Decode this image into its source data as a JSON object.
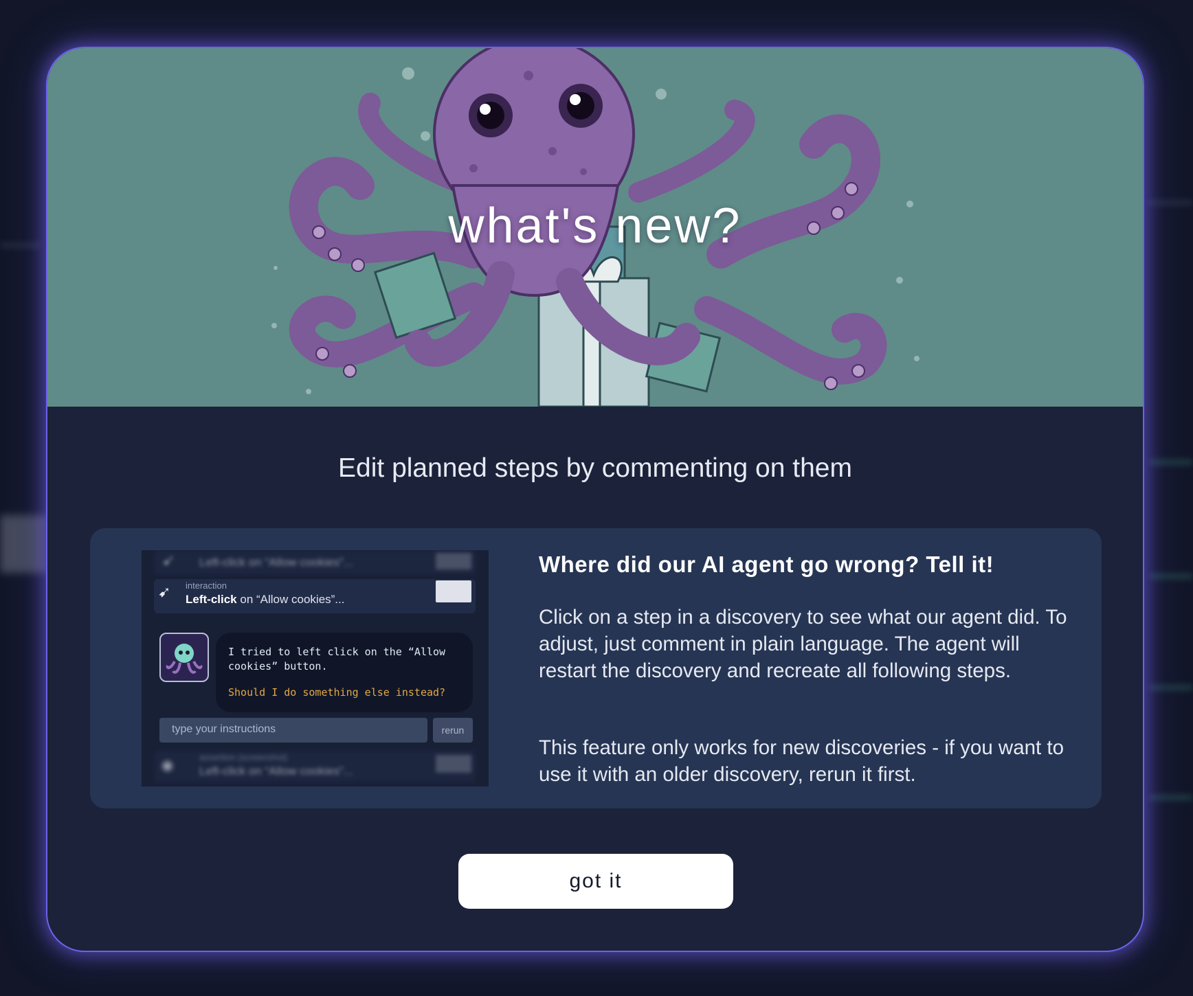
{
  "modal": {
    "title": "what's new?",
    "subtitle": "Edit planned steps by commenting on them",
    "feature": {
      "heading": "Where did our AI agent go wrong? Tell it!",
      "paragraph1": "Click on a step in a discovery to see what our agent did. To adjust, just comment in plain language. The agent will restart the discovery and recreate all following steps.",
      "paragraph2": "This feature only works for new discoveries - if you want to use it with an older discovery, rerun it first."
    },
    "preview": {
      "row_label": "interaction",
      "row_action_bold": "Left-click",
      "row_action_rest": " on “Allow cookies”...",
      "blurred_row_top": "Left-click on “Allow cookies”...",
      "blurred_row_bottom_label": "assertion (screenshot)",
      "blurred_row_bottom": "Left-click on “Allow cookies”...",
      "bubble_text": "I tried to left click on the “Allow cookies” button.",
      "bubble_question": "Should I do something else instead?",
      "input_placeholder": "type your instructions",
      "rerun_label": "rerun"
    },
    "got_it_label": "got it"
  },
  "colors": {
    "accent_border": "#6b63e8",
    "hero_background": "#5f8c88",
    "modal_background": "#1b2239",
    "card_background": "#263553",
    "question_color": "#e3a847"
  }
}
